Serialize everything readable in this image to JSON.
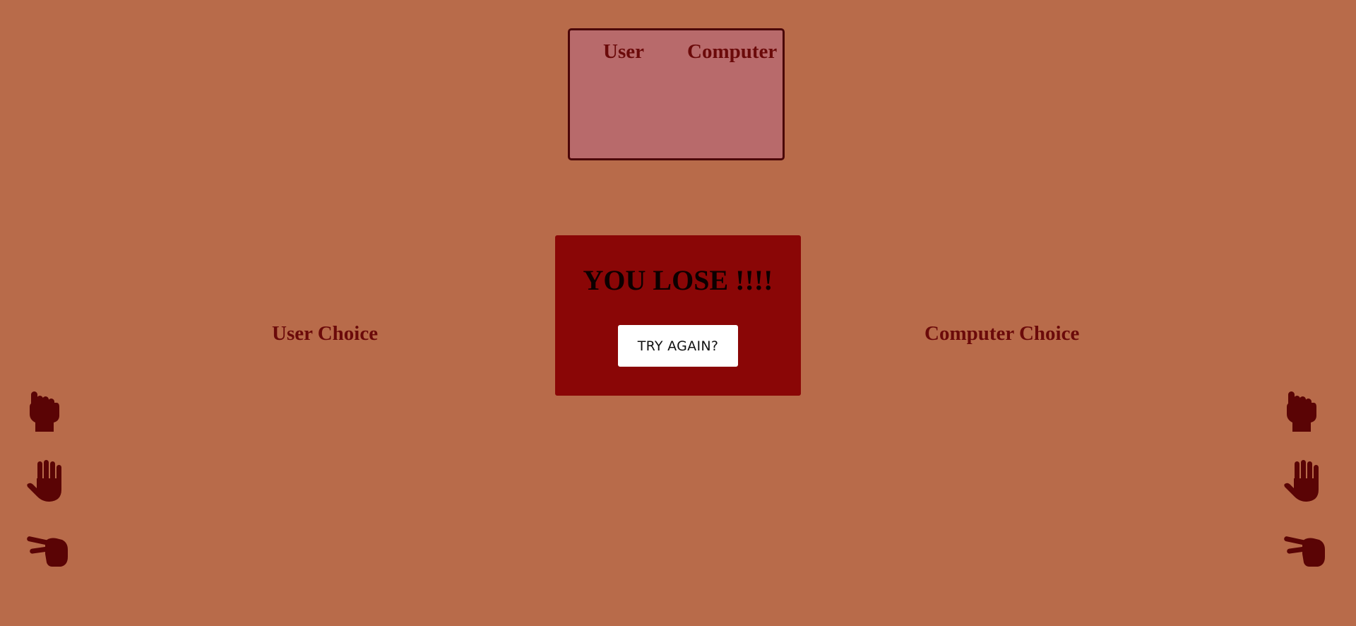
{
  "scoreboard": {
    "user_label": "User",
    "computer_label": "Computer"
  },
  "choices": {
    "user_title": "User Choice",
    "computer_title": "Computer Choice"
  },
  "result": {
    "message": "YOU LOSE !!!!",
    "button_label": "TRY AGAIN?"
  },
  "icons": {
    "user": [
      "rock-hand-icon",
      "paper-hand-icon",
      "scissors-hand-icon"
    ],
    "computer": [
      "rock-hand-icon",
      "paper-hand-icon",
      "scissors-hand-icon"
    ]
  },
  "colors": {
    "background": "#b86b4a",
    "scoreboard_fill": "#b86a6b",
    "scoreboard_border": "#4a0508",
    "text": "#6b0a0a",
    "modal": "#8a0606",
    "icon": "#5a0405",
    "button": "#ffffff"
  }
}
